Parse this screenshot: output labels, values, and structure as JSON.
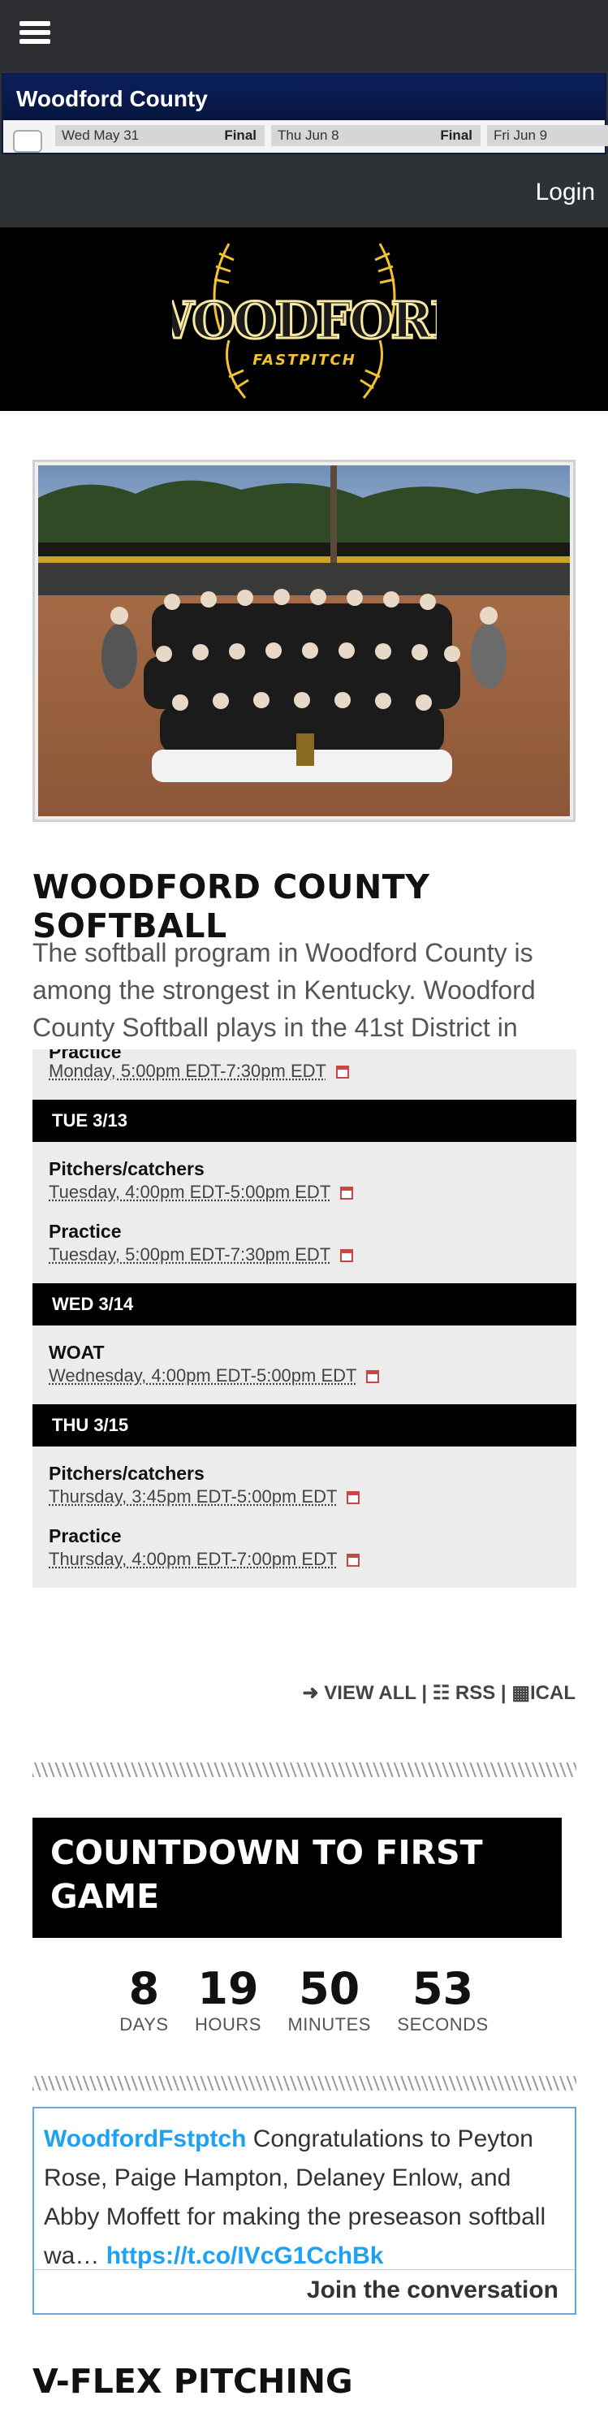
{
  "header": {
    "menu_icon": "hamburger-icon"
  },
  "scoreboard": {
    "title": "Woodford County",
    "games": [
      {
        "date": "Wed May 31",
        "result": "Final"
      },
      {
        "date": "Thu Jun 8",
        "result": "Final"
      },
      {
        "date": "Fri Jun 9",
        "result": ""
      }
    ]
  },
  "nav": {
    "login": "Login"
  },
  "logo": {
    "word": "WOODFORD",
    "sub": "FASTPITCH"
  },
  "page": {
    "title": "WOODFORD COUNTY SOFTBALL",
    "intro": "The softball program in Woodford County is among the strongest in Kentucky. Woodford County Softball plays in the 41st District in"
  },
  "calendar": {
    "partial_event": {
      "title": "Practice",
      "time": "Monday, 5:00pm EDT-7:30pm EDT"
    },
    "days": [
      {
        "label": "TUE 3/13",
        "events": [
          {
            "title": "Pitchers/catchers",
            "time": "Tuesday, 4:00pm EDT-5:00pm EDT"
          },
          {
            "title": "Practice",
            "time": "Tuesday, 5:00pm EDT-7:30pm EDT"
          }
        ]
      },
      {
        "label": "WED 3/14",
        "events": [
          {
            "title": "WOAT",
            "time": "Wednesday, 4:00pm EDT-5:00pm EDT"
          }
        ]
      },
      {
        "label": "THU 3/15",
        "events": [
          {
            "title": "Pitchers/catchers",
            "time": "Thursday, 3:45pm EDT-5:00pm EDT"
          },
          {
            "title": "Practice",
            "time": "Thursday, 4:00pm EDT-7:00pm EDT"
          }
        ]
      }
    ],
    "links": {
      "view_all": "VIEW ALL",
      "rss": "RSS",
      "ical": "ICAL"
    }
  },
  "countdown": {
    "title": "COUNTDOWN TO FIRST GAME",
    "days": "8",
    "days_label": "DAYS",
    "hours": "19",
    "hours_label": "HOURS",
    "minutes": "50",
    "minutes_label": "MINUTES",
    "seconds": "53",
    "seconds_label": "SECONDS"
  },
  "twitter": {
    "user": "WoodfordFstptch",
    "text": "Congratulations to Peyton Rose, Paige Hampton, Delaney Enlow, and Abby Moffett for making the preseason softball wa…",
    "link": "https://t.co/IVcG1CchBk",
    "footer": "Join the conversation"
  },
  "next_section": {
    "title": "V-FLEX PITCHING"
  }
}
